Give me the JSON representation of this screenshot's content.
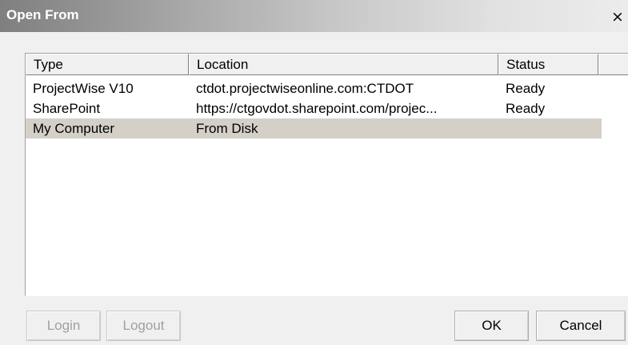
{
  "dialog": {
    "title": "Open From",
    "close_glyph": "×"
  },
  "list": {
    "columns": [
      "Type",
      "Location",
      "Status",
      ""
    ],
    "rows": [
      {
        "type": "ProjectWise V10",
        "location": "ctdot.projectwiseonline.com:CTDOT",
        "status": "Ready",
        "selected": false
      },
      {
        "type": "SharePoint",
        "location": "https://ctgovdot.sharepoint.com/projec...",
        "status": "Ready",
        "selected": false
      },
      {
        "type": "My Computer",
        "location": "From Disk",
        "status": "",
        "selected": true
      }
    ]
  },
  "buttons": {
    "login": "Login",
    "logout": "Logout",
    "ok": "OK",
    "cancel": "Cancel"
  },
  "icons": {
    "close": "close-icon"
  },
  "colors": {
    "selected_row": "#d4d0c8",
    "disabled_text": "#a0a0a0"
  }
}
